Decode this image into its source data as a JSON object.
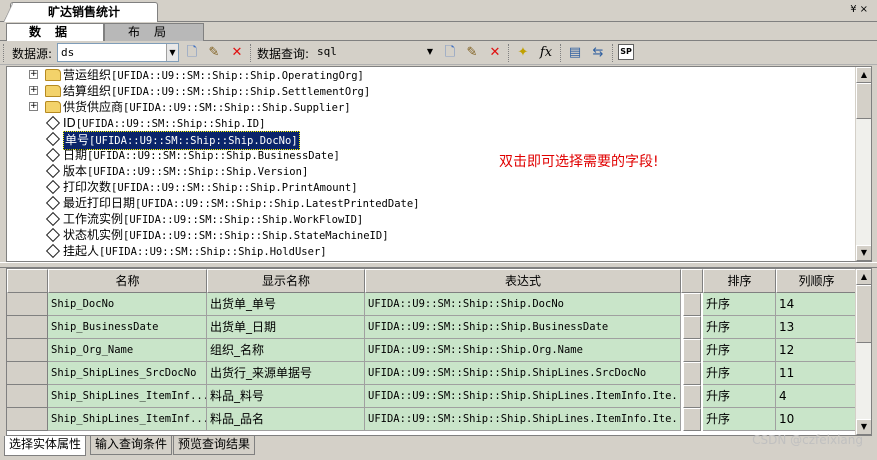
{
  "window": {
    "title": "旷达销售统计",
    "controls": "¥ ×"
  },
  "top_tabs": [
    {
      "label": "数据",
      "active": true
    },
    {
      "label": "布局",
      "active": false
    }
  ],
  "toolbar": {
    "datasource_label": "数据源:",
    "datasource_value": "ds",
    "query_label": "数据查询:",
    "query_value": "sql",
    "icons": [
      "new-doc-icon",
      "edit-icon",
      "delete-icon",
      "new-doc-icon",
      "edit-icon",
      "delete-icon",
      "wizard-icon",
      "function-icon",
      "preview-icon",
      "refresh-icon",
      "sql-icon"
    ]
  },
  "tree": {
    "nodes": [
      {
        "type": "folder",
        "expanded": false,
        "cn": "营运组织",
        "en": "[UFIDA::U9::SM::Ship::Ship.OperatingOrg]"
      },
      {
        "type": "folder",
        "expanded": false,
        "cn": "结算组织",
        "en": "[UFIDA::U9::SM::Ship::Ship.SettlementOrg]"
      },
      {
        "type": "folder",
        "expanded": false,
        "cn": "供货供应商",
        "en": "[UFIDA::U9::SM::Ship::Ship.Supplier]"
      },
      {
        "type": "field",
        "cn": "ID",
        "en": "[UFIDA::U9::SM::Ship::Ship.ID]"
      },
      {
        "type": "field",
        "cn": "单号",
        "en": "[UFIDA::U9::SM::Ship::Ship.DocNo]",
        "selected": true
      },
      {
        "type": "field",
        "cn": "日期",
        "en": "[UFIDA::U9::SM::Ship::Ship.BusinessDate]"
      },
      {
        "type": "field",
        "cn": "版本",
        "en": "[UFIDA::U9::SM::Ship::Ship.Version]"
      },
      {
        "type": "field",
        "cn": "打印次数",
        "en": "[UFIDA::U9::SM::Ship::Ship.PrintAmount]"
      },
      {
        "type": "field",
        "cn": "最近打印日期",
        "en": "[UFIDA::U9::SM::Ship::Ship.LatestPrintedDate]"
      },
      {
        "type": "field",
        "cn": "工作流实例",
        "en": "[UFIDA::U9::SM::Ship::Ship.WorkFlowID]"
      },
      {
        "type": "field",
        "cn": "状态机实例",
        "en": "[UFIDA::U9::SM::Ship::Ship.StateMachineID]"
      },
      {
        "type": "field",
        "cn": "挂起人",
        "en": "[UFIDA::U9::SM::Ship::Ship.HoldUser]"
      }
    ],
    "hint": "双击即可选择需要的字段!"
  },
  "grid": {
    "columns": [
      "",
      "名称",
      "显示名称",
      "表达式",
      "",
      "排序",
      "列顺序"
    ],
    "rows": [
      {
        "name": "Ship_DocNo",
        "display": "出货单_单号",
        "expr": "UFIDA::U9::SM::Ship::Ship.DocNo",
        "sort": "升序",
        "order": "14"
      },
      {
        "name": "Ship_BusinessDate",
        "display": "出货单_日期",
        "expr": "UFIDA::U9::SM::Ship::Ship.BusinessDate",
        "sort": "升序",
        "order": "13"
      },
      {
        "name": "Ship_Org_Name",
        "display": "组织_名称",
        "expr": "UFIDA::U9::SM::Ship::Ship.Org.Name",
        "sort": "升序",
        "order": "12"
      },
      {
        "name": "Ship_ShipLines_SrcDocNo",
        "display": "出货行_来源单据号",
        "expr": "UFIDA::U9::SM::Ship::Ship.ShipLines.SrcDocNo",
        "sort": "升序",
        "order": "11"
      },
      {
        "name": "Ship_ShipLines_ItemInf...",
        "display": "料品_料号",
        "expr": "UFIDA::U9::SM::Ship::Ship.ShipLines.ItemInfo.Ite...",
        "sort": "升序",
        "order": "4"
      },
      {
        "name": "Ship_ShipLines_ItemInf...",
        "display": "料品_品名",
        "expr": "UFIDA::U9::SM::Ship::Ship.ShipLines.ItemInfo.Ite...",
        "sort": "升序",
        "order": "10"
      }
    ]
  },
  "bottom_tabs": [
    {
      "label": "选择实体属性",
      "active": true
    },
    {
      "label": "输入查询条件",
      "active": false
    },
    {
      "label": "预览查询结果",
      "active": false
    }
  ],
  "watermark": "CSDN @czfeixiang"
}
